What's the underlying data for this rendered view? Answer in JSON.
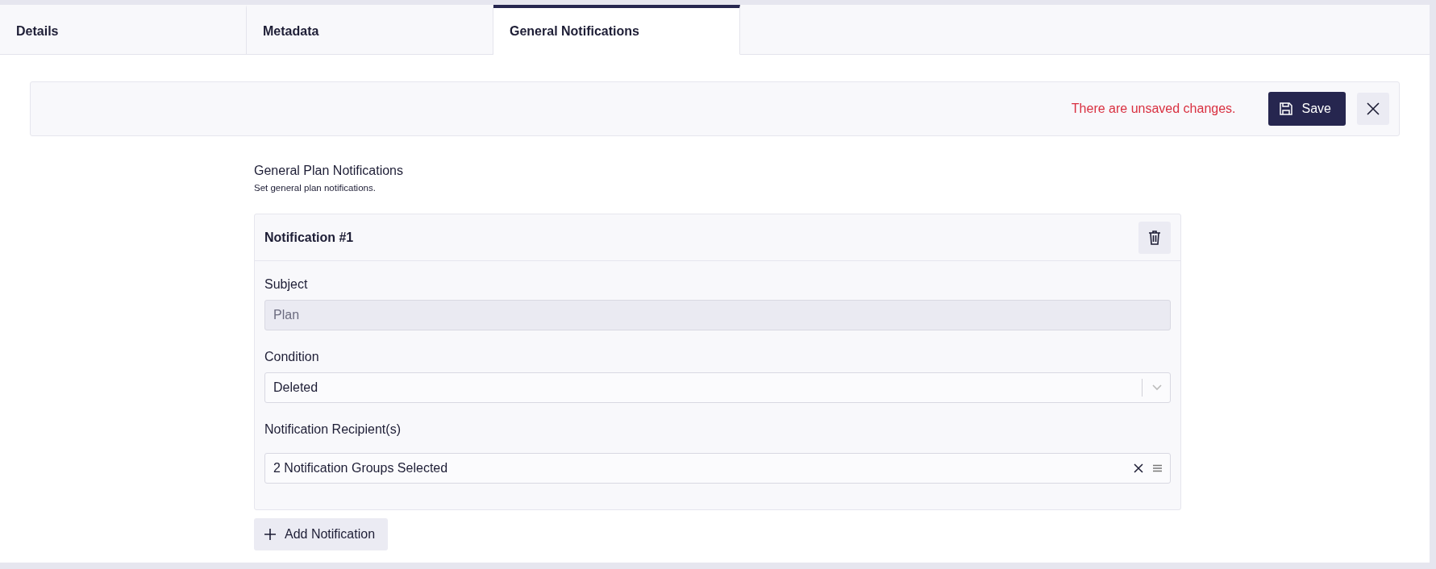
{
  "tabs": [
    {
      "label": "Details",
      "selected": false
    },
    {
      "label": "Metadata",
      "selected": false
    },
    {
      "label": "General Notifications",
      "selected": true
    }
  ],
  "unsaved_bar": {
    "message": "There are unsaved changes.",
    "save_label": "Save"
  },
  "section": {
    "title": "General Plan Notifications",
    "subtitle": "Set general plan notifications."
  },
  "notifications": [
    {
      "title": "Notification #1",
      "fields": [
        {
          "kind": "text",
          "label": "Subject",
          "value": "Plan",
          "disabled": true
        },
        {
          "kind": "select",
          "label": "Condition",
          "value": "Deleted",
          "disabled": false
        },
        {
          "kind": "multiselect",
          "label": "Notification Recipient(s)",
          "value": "2 Notification Groups Selected",
          "disabled": false
        }
      ]
    }
  ],
  "add_label": "Add Notification"
}
